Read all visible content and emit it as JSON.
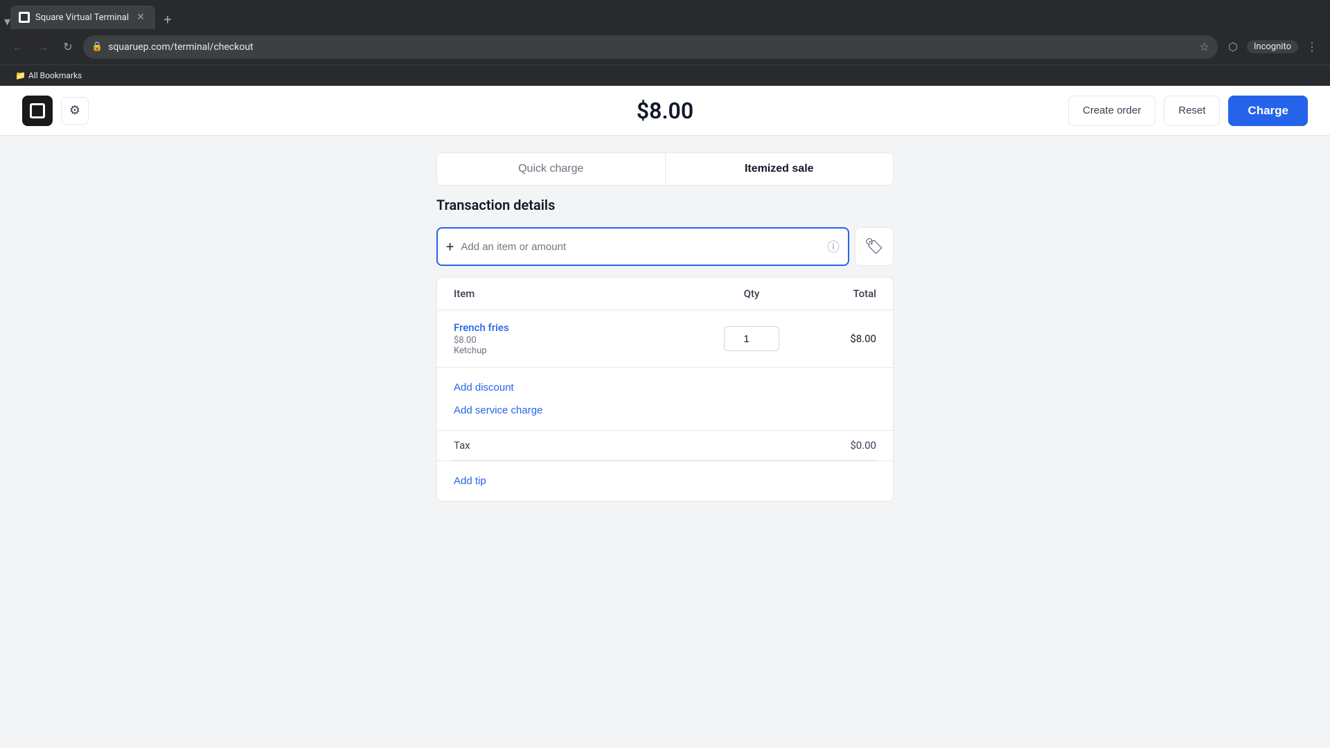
{
  "browser": {
    "tab_label": "Square Virtual Terminal",
    "url": "squaruep.com/terminal/checkout",
    "url_display": "squaruep.com/terminal/checkout",
    "bookmarks_label": "All Bookmarks"
  },
  "header": {
    "amount": "$8.00",
    "create_order_label": "Create order",
    "reset_label": "Reset",
    "charge_label": "Charge"
  },
  "tabs": {
    "quick_charge_label": "Quick charge",
    "itemized_sale_label": "Itemized sale",
    "active": "itemized_sale"
  },
  "transaction_details": {
    "title": "Transaction details",
    "input_placeholder": "Add an item or amount"
  },
  "table": {
    "columns": {
      "item": "Item",
      "qty": "Qty",
      "total": "Total"
    },
    "rows": [
      {
        "name": "French fries",
        "price": "$8.00",
        "modifier": "Ketchup",
        "qty": "1",
        "total": "$8.00"
      }
    ],
    "add_discount_label": "Add discount",
    "add_service_charge_label": "Add service charge",
    "tax_label": "Tax",
    "tax_value": "$0.00",
    "add_tip_label": "Add tip"
  },
  "icons": {
    "gear": "⚙",
    "plus": "+",
    "info": "ⓘ",
    "coupon": "🏷",
    "back": "←",
    "forward": "→",
    "refresh": "↻",
    "star": "☆",
    "profile": "👤",
    "menu": "⋮",
    "close_tab": "✕",
    "new_tab": "+"
  },
  "colors": {
    "accent_blue": "#2563eb",
    "text_dark": "#111827",
    "text_gray": "#6b7280",
    "border": "#e5e7eb"
  }
}
